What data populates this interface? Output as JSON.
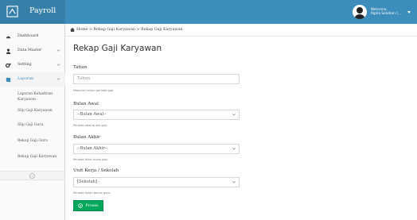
{
  "app": {
    "brand": "Payroll",
    "user_greeting": "Welcome,",
    "user_name": "Alpha Solution (..."
  },
  "sidebar": {
    "items": [
      {
        "label": "Dashboard",
        "icon": "dashboard-icon"
      },
      {
        "label": "Data Master",
        "icon": "user-icon"
      },
      {
        "label": "Setting",
        "icon": "gears-icon"
      },
      {
        "label": "Laporan",
        "icon": "book-icon"
      }
    ],
    "sub_items": [
      {
        "label": "Laporan Kehadiran Karyawan"
      },
      {
        "label": "Slip Gaji Karyawan"
      },
      {
        "label": "Slip Gaji Guru"
      },
      {
        "label": "Rekap Gaji Guru"
      },
      {
        "label": "Rekap Gaji Karyawan"
      }
    ],
    "collapse_glyph": "‹"
  },
  "breadcrumb": {
    "text": "Home  >  Rekap Gaji Karyawan  >  Rekap Gaji Karyawan"
  },
  "page": {
    "title": "Rekap Gaji Karyawan"
  },
  "form": {
    "tahun": {
      "label": "Tahun",
      "placeholder": "Tahun",
      "help": "Masukan tahun periode gaji."
    },
    "bulan_awal": {
      "label": "Bulan Awal",
      "value": "--Bulan Awal--",
      "help": "Periode awal bulan gaji."
    },
    "bulan_akhir": {
      "label": "Bulan Akhir",
      "value": "--Bulan Akhir--",
      "help": "Periode Akhir bulan gaji."
    },
    "unit_kerja": {
      "label": "Unit Kerja / Sekolah",
      "value": "[Sekolah] -",
      "help": "Periode bulan bonus guru."
    },
    "submit_label": "Proses"
  },
  "colors": {
    "header": "#3c8dbc",
    "brand_bg": "#367fa9",
    "submit": "#00a65a"
  }
}
